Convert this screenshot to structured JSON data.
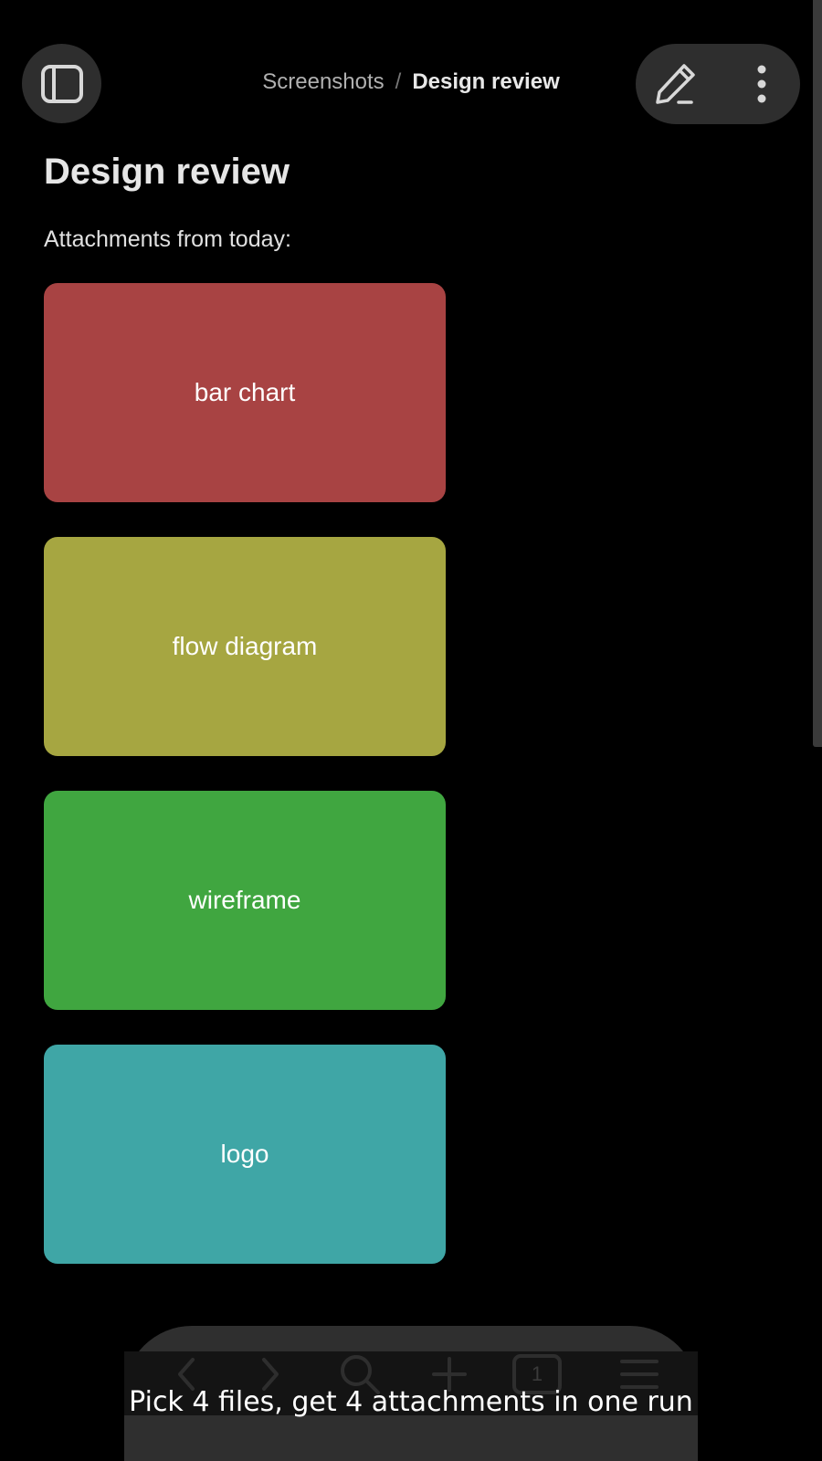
{
  "header": {
    "breadcrumb_parent": "Screenshots",
    "breadcrumb_separator": "/",
    "breadcrumb_current": "Design review"
  },
  "page": {
    "title": "Design review",
    "intro": "Attachments from today:"
  },
  "attachments": [
    {
      "label": "bar chart",
      "color": "#a84343"
    },
    {
      "label": "flow diagram",
      "color": "#a6a641"
    },
    {
      "label": "wireframe",
      "color": "#40a640"
    },
    {
      "label": "logo",
      "color": "#3fa6a6"
    }
  ],
  "toolbar": {
    "tab_count": "1"
  },
  "caption": "Pick 4 files, get 4 attachments in one run",
  "icons": {
    "sidebar": "sidebar-toggle-icon",
    "edit": "pencil-icon",
    "more": "more-vertical-icon",
    "back": "chevron-left-icon",
    "forward": "chevron-right-icon",
    "search": "search-icon",
    "new": "plus-icon",
    "tabs": "tabs-icon",
    "menu": "hamburger-menu-icon"
  },
  "colors": {
    "background": "#000000",
    "surface": "#2e2e2e",
    "text": "#e6e6e6"
  }
}
